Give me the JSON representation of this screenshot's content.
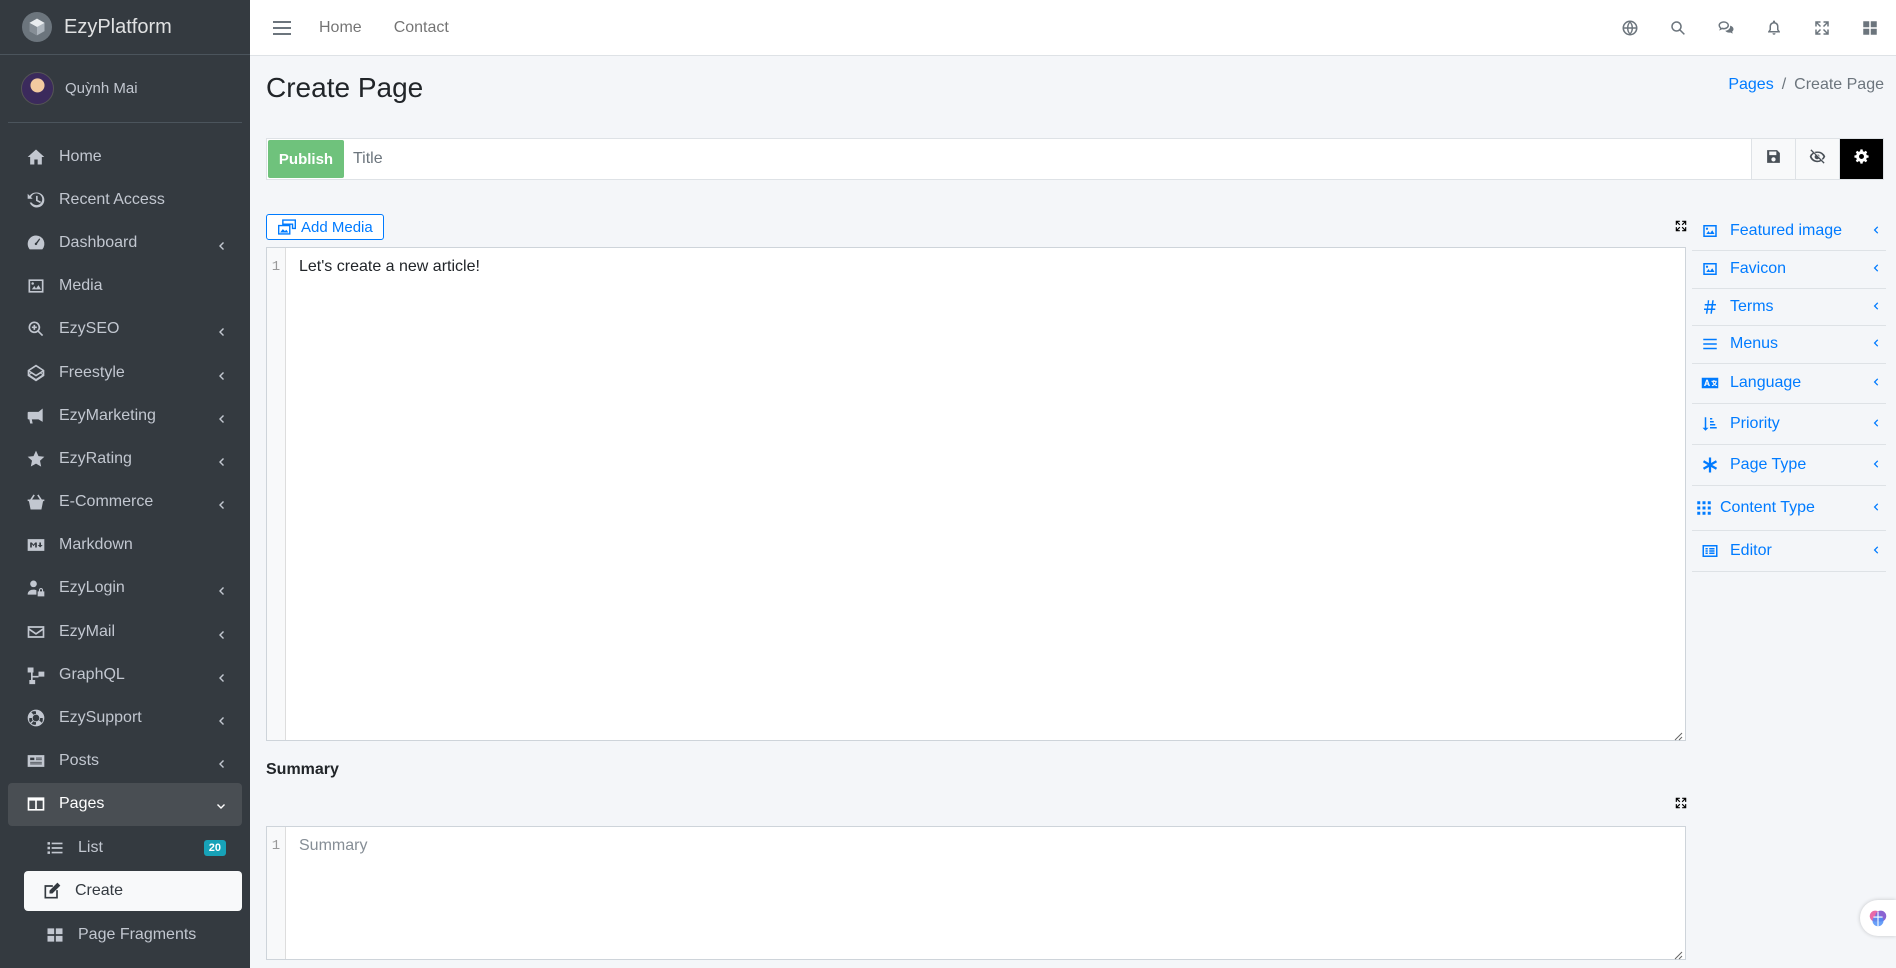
{
  "brand": {
    "name": "EzyPlatform"
  },
  "user": {
    "name": "Quỳnh Mai"
  },
  "sidebar": {
    "items": [
      {
        "label": "Home",
        "icon": "home-icon"
      },
      {
        "label": "Recent Access",
        "icon": "history-icon"
      },
      {
        "label": "Dashboard",
        "icon": "gauge-icon"
      },
      {
        "label": "Media",
        "icon": "image-icon"
      },
      {
        "label": "EzySEO",
        "icon": "search-plus-icon"
      },
      {
        "label": "Freestyle",
        "icon": "codepen-icon"
      },
      {
        "label": "EzyMarketing",
        "icon": "bullhorn-icon"
      },
      {
        "label": "EzyRating",
        "icon": "star-icon"
      },
      {
        "label": "E-Commerce",
        "icon": "basket-icon"
      },
      {
        "label": "Markdown",
        "icon": "markdown-icon"
      },
      {
        "label": "EzyLogin",
        "icon": "user-lock-icon"
      },
      {
        "label": "EzyMail",
        "icon": "envelope-icon"
      },
      {
        "label": "GraphQL",
        "icon": "graph-icon"
      },
      {
        "label": "EzySupport",
        "icon": "lifebuoy-icon"
      },
      {
        "label": "Posts",
        "icon": "newspaper-icon"
      },
      {
        "label": "Pages",
        "icon": "columns-icon"
      }
    ],
    "sub_items": [
      {
        "label": "List",
        "icon": "list-icon",
        "badge": "20"
      },
      {
        "label": "Create",
        "icon": "edit-icon"
      },
      {
        "label": "Page Fragments",
        "icon": "grid-icon"
      }
    ]
  },
  "topbar": {
    "links": [
      "Home",
      "Contact"
    ],
    "icons": [
      "globe-icon",
      "search-icon",
      "comments-icon",
      "bell-icon",
      "fullscreen-icon",
      "apps-icon"
    ]
  },
  "page": {
    "title": "Create Page",
    "breadcrumb": {
      "parent": "Pages",
      "current": "Create Page"
    }
  },
  "form": {
    "publish_label": "Publish",
    "title_placeholder": "Title",
    "add_media_label": "Add Media",
    "editor": {
      "line": "1",
      "content": "Let's create a new article!"
    },
    "summary": {
      "label": "Summary",
      "line": "1",
      "placeholder": "Summary"
    }
  },
  "right_panel": {
    "items": [
      {
        "label": "Featured image",
        "icon": "image-icon"
      },
      {
        "label": "Favicon",
        "icon": "image-icon"
      },
      {
        "label": "Terms",
        "icon": "hashtag-icon"
      },
      {
        "label": "Menus",
        "icon": "bars-icon"
      },
      {
        "label": "Language",
        "icon": "language-icon"
      },
      {
        "label": "Priority",
        "icon": "sort-icon"
      },
      {
        "label": "Page Type",
        "icon": "asterisk-icon"
      },
      {
        "label": "Content Type",
        "icon": "grid-icon"
      },
      {
        "label": "Editor",
        "icon": "rectangle-list-icon"
      }
    ]
  },
  "colors": {
    "sidebar_bg": "#343a40",
    "accent": "#007bff",
    "publish": "#6fc27c",
    "badge": "#17a2b8"
  }
}
